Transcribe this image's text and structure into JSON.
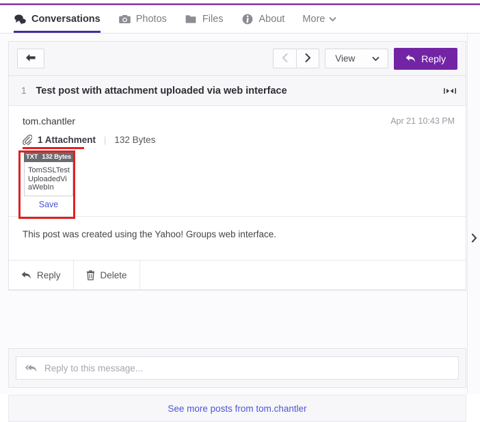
{
  "nav": {
    "items": [
      {
        "label": "Conversations",
        "icon": "conversations-icon",
        "active": true
      },
      {
        "label": "Photos",
        "icon": "camera-icon",
        "active": false
      },
      {
        "label": "Files",
        "icon": "folder-icon",
        "active": false
      },
      {
        "label": "About",
        "icon": "info-circle-icon",
        "active": false
      },
      {
        "label": "More",
        "icon": "chevron-down-icon",
        "active": false
      }
    ]
  },
  "toolbar": {
    "back_icon": "arrow-left-icon",
    "prev_icon": "chevron-left-icon",
    "next_icon": "chevron-right-icon",
    "view_label": "View",
    "view_chevron": "chevron-down-icon",
    "reply_label": "Reply",
    "reply_icon": "reply-arrow-icon"
  },
  "post": {
    "number": "1",
    "subject": "Test post with attachment uploaded via web interface",
    "collapse_icon": "collapse-horizontal-icon",
    "author": "tom.chantler",
    "timestamp": "Apr 21 10:43 PM",
    "body": "This post was created using the Yahoo! Groups web interface."
  },
  "attachment": {
    "clip_icon": "paperclip-icon",
    "count_label": "1 Attachment",
    "separator": "|",
    "total_size": "132 Bytes",
    "tile": {
      "type_badge": "TXT",
      "size_badge": "132 Bytes",
      "filename": "TomSSLTestUploadedViaWebIn",
      "save_label": "Save"
    }
  },
  "actions": [
    {
      "label": "Reply",
      "icon": "reply-arrow-icon"
    },
    {
      "label": "Delete",
      "icon": "trash-icon"
    }
  ],
  "reply_box": {
    "icon": "reply-all-icon",
    "placeholder": "Reply to this message...",
    "value": ""
  },
  "footer": {
    "link_label": "See more posts from tom.chantler"
  },
  "rail": {
    "expand_icon": "chevron-right-icon"
  },
  "colors": {
    "accent_purple": "#7324a5",
    "top_rule": "#7b2fa0",
    "active_tab_underline": "#3c2fa0",
    "link_blue": "#4b55d8",
    "annotation_red": "#e02020",
    "badge_gray": "#6b6b72"
  }
}
